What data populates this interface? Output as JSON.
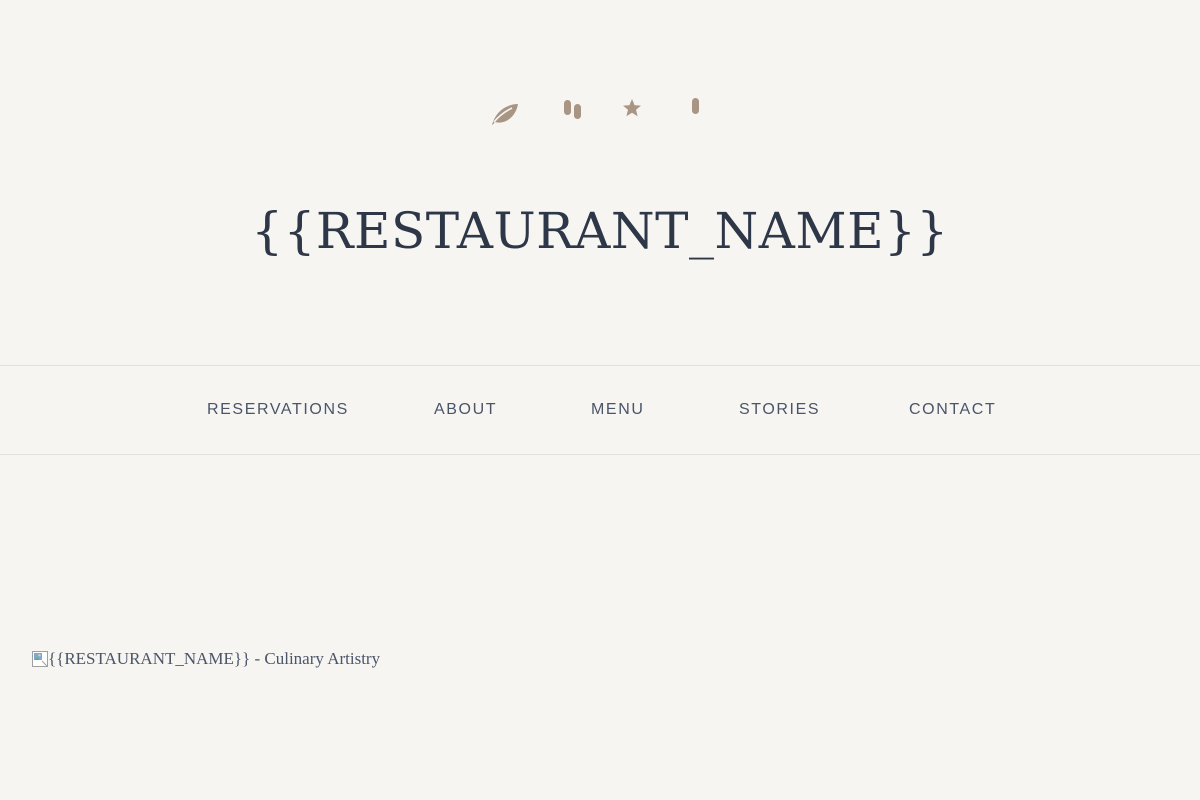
{
  "header": {
    "icons": [
      "leaf-icon",
      "cups-icon",
      "star-icon",
      "pill-icon"
    ],
    "title": "{{RESTAURANT_NAME}}"
  },
  "nav": {
    "items": [
      {
        "label": "RESERVATIONS"
      },
      {
        "label": "ABOUT"
      },
      {
        "label": "MENU"
      },
      {
        "label": "STORIES"
      },
      {
        "label": "CONTACT"
      }
    ]
  },
  "hero": {
    "image_alt": "{{RESTAURANT_NAME}} - Culinary Artistry"
  },
  "colors": {
    "background": "#f7f5f2",
    "accent": "#a89584",
    "text": "#2d3748",
    "nav_text": "#4a5568",
    "divider": "#e3e0dc"
  }
}
